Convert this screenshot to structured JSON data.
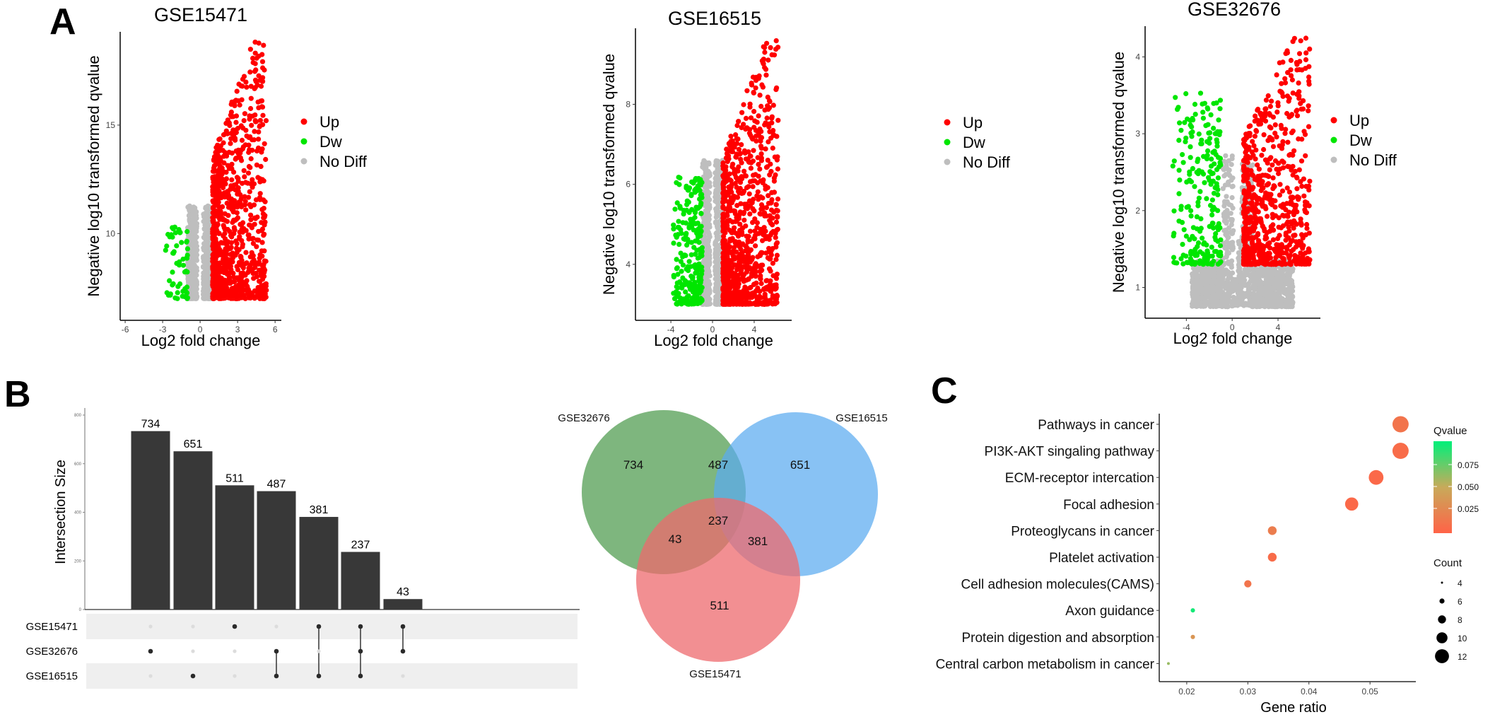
{
  "figure": {
    "panel_labels": [
      "A",
      "B",
      "C"
    ]
  },
  "colors": {
    "up": "#ff0000",
    "dw": "#00e600",
    "nodiff": "#bebebe",
    "bar": "#383838",
    "venn_gse32676": "#5aa25a",
    "venn_gse16515": "#5aaaf0",
    "venn_gse15471": "#ee6a6e",
    "qvalue_low": "#ff6347",
    "qvalue_high": "#00f07a"
  },
  "chart_data": [
    {
      "id": "volcano_gse15471",
      "type": "scatter",
      "title": "GSE15471",
      "xlabel": "Log2 fold change",
      "ylabel": "Negative log10 transformed qvalue",
      "xticks": [
        -6,
        -3,
        0,
        3,
        6
      ],
      "yticks": [
        10,
        15
      ],
      "xlim": [
        -6.4,
        6.5
      ],
      "ylim": [
        6,
        19.3
      ],
      "legend": {
        "position": "right",
        "entries": [
          "Up",
          "Dw",
          "No Diff"
        ]
      },
      "clusters": {
        "up": {
          "xmin": 1.0,
          "xmax": 5.3,
          "ymin": 7.0,
          "ymax": 18.9,
          "n": 900
        },
        "dw": {
          "xmin": -2.8,
          "xmax": -1.0,
          "ymin": 7.0,
          "ymax": 10.3,
          "n": 55
        },
        "nodiff": {
          "xmin": -1.0,
          "xmax": 1.0,
          "ymin": 7.0,
          "ymax": 11.3,
          "n": 700
        }
      }
    },
    {
      "id": "volcano_gse16515",
      "type": "scatter",
      "title": "GSE16515",
      "xlabel": "Log2 fold change",
      "ylabel": "Negative log10 transformed qvalue",
      "xticks": [
        -4,
        0,
        4
      ],
      "yticks": [
        4,
        6,
        8
      ],
      "xlim": [
        -7.4,
        7.6
      ],
      "ylim": [
        2.6,
        9.9
      ],
      "legend": {
        "position": "right",
        "entries": [
          "Up",
          "Dw",
          "No Diff"
        ]
      },
      "clusters": {
        "up": {
          "xmin": 1.0,
          "xmax": 6.3,
          "ymin": 3.0,
          "ymax": 9.6,
          "n": 950
        },
        "dw": {
          "xmin": -3.8,
          "xmax": -1.0,
          "ymin": 3.0,
          "ymax": 6.2,
          "n": 260
        },
        "nodiff": {
          "xmin": -1.0,
          "xmax": 1.0,
          "ymin": 3.0,
          "ymax": 6.6,
          "n": 700
        }
      }
    },
    {
      "id": "volcano_gse32676",
      "type": "scatter",
      "title": "GSE32676",
      "xlabel": "Log2 fold change",
      "ylabel": "Negative log10 transformed qvalue",
      "xticks": [
        -4,
        0,
        4
      ],
      "yticks": [
        1,
        2,
        3,
        4
      ],
      "xlim": [
        -7.6,
        7.7
      ],
      "ylim": [
        0.6,
        4.4
      ],
      "legend": {
        "position": "right",
        "entries": [
          "Up",
          "Dw",
          "No Diff"
        ]
      },
      "clusters": {
        "up": {
          "xmin": 1.0,
          "xmax": 6.8,
          "ymin": 1.3,
          "ymax": 4.3,
          "n": 700
        },
        "dw": {
          "xmin": -5.2,
          "xmax": -1.0,
          "ymin": 1.3,
          "ymax": 3.55,
          "n": 230
        },
        "nodiff": {
          "xmin": -3.5,
          "xmax": 5.3,
          "ymin": 0.75,
          "ymax": 3.6,
          "n": 1400
        }
      }
    },
    {
      "id": "upset",
      "type": "bar",
      "ylabel": "Intersection Size",
      "yticks": [
        0,
        200,
        400,
        600,
        800
      ],
      "ylim": [
        0,
        830
      ],
      "sets": [
        "GSE15471",
        "GSE32676",
        "GSE16515"
      ],
      "values": [
        734,
        651,
        511,
        487,
        381,
        237,
        43
      ],
      "membership": [
        [
          "GSE32676"
        ],
        [
          "GSE16515"
        ],
        [
          "GSE15471"
        ],
        [
          "GSE32676",
          "GSE16515"
        ],
        [
          "GSE15471",
          "GSE16515"
        ],
        [
          "GSE15471",
          "GSE32676",
          "GSE16515"
        ],
        [
          "GSE15471",
          "GSE32676"
        ]
      ]
    },
    {
      "id": "venn",
      "type": "venn",
      "sets": [
        "GSE32676",
        "GSE16515",
        "GSE15471"
      ],
      "regions": {
        "GSE32676_only": 734,
        "GSE16515_only": 651,
        "GSE15471_only": 511,
        "GSE32676_GSE16515": 487,
        "GSE32676_GSE15471": 43,
        "GSE16515_GSE15471": 381,
        "all": 237
      }
    },
    {
      "id": "kegg_dotplot",
      "type": "scatter",
      "xlabel": "Gene ratio",
      "xticks": [
        0.02,
        0.03,
        0.04,
        0.05
      ],
      "xlim": [
        0.0155,
        0.0575
      ],
      "categories": [
        "Pathways in cancer",
        "PI3K-AKT singaling pathway",
        "ECM-receptor intercation",
        "Focal adhesion",
        "Proteoglycans in cancer",
        "Platelet activation",
        "Cell adhesion molecules(CAMS)",
        "Axon guidance",
        "Protein digestion and absorption",
        "Central carbon metabolism in cancer"
      ],
      "gene_ratio": [
        0.055,
        0.055,
        0.051,
        0.047,
        0.034,
        0.034,
        0.03,
        0.021,
        0.021,
        0.017
      ],
      "count": [
        13,
        13,
        12,
        11,
        8,
        8,
        7,
        5,
        5,
        4
      ],
      "qvalue": [
        0.012,
        0.006,
        0.004,
        0.004,
        0.018,
        0.006,
        0.012,
        0.095,
        0.035,
        0.062
      ],
      "legend_qvalue": {
        "title": "Qvalue",
        "ticks": [
          "0.075",
          "0.050",
          "0.025"
        ],
        "min": 0.0,
        "max": 0.1
      },
      "legend_count": {
        "title": "Count",
        "values": [
          4,
          6,
          8,
          10,
          12
        ]
      }
    }
  ]
}
